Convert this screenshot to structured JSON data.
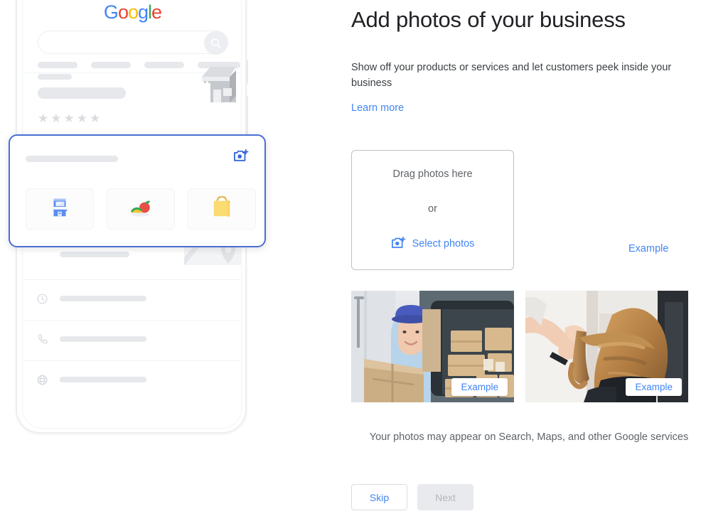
{
  "form": {
    "title": "Add photos of your business",
    "subtitle": "Show off your products or services and let customers peek inside your business",
    "learn_more": "Learn more",
    "dropzone": {
      "drag_label": "Drag photos here",
      "or_label": "or",
      "select_label": "Select photos",
      "camera_icon": "add-a-photo-icon"
    },
    "example_link": "Example",
    "photos": [
      {
        "badge": "Example",
        "alt": "delivery-person-with-boxes"
      },
      {
        "badge": "Example",
        "alt": "hair-stylist-brushing-hair"
      }
    ],
    "disclaimer": "Your photos may appear on Search, Maps, and other Google services",
    "buttons": {
      "skip": "Skip",
      "next": "Next"
    }
  },
  "phone": {
    "logo": {
      "letters": [
        "G",
        "o",
        "o",
        "g",
        "l",
        "e"
      ]
    },
    "search": {
      "placeholder": "",
      "icon": "search-icon"
    },
    "highlight_card": {
      "camera_icon": "add-a-photo-icon",
      "tiles": [
        "storefront-icon",
        "food-icon",
        "shopping-bag-icon"
      ]
    },
    "rows": [
      {
        "icon": "location-pin-icon"
      },
      {
        "icon": "clock-icon"
      },
      {
        "icon": "phone-icon"
      },
      {
        "icon": "globe-icon"
      }
    ]
  },
  "colors": {
    "accent": "#4285f4",
    "google_blue": "#4285F4",
    "google_red": "#EA4335",
    "google_yellow": "#FBBC05",
    "google_green": "#34A853",
    "text_primary": "#202124",
    "text_secondary": "#5f6368",
    "skeleton": "#e6e8eb",
    "highlight_border": "#4a6fd4"
  }
}
